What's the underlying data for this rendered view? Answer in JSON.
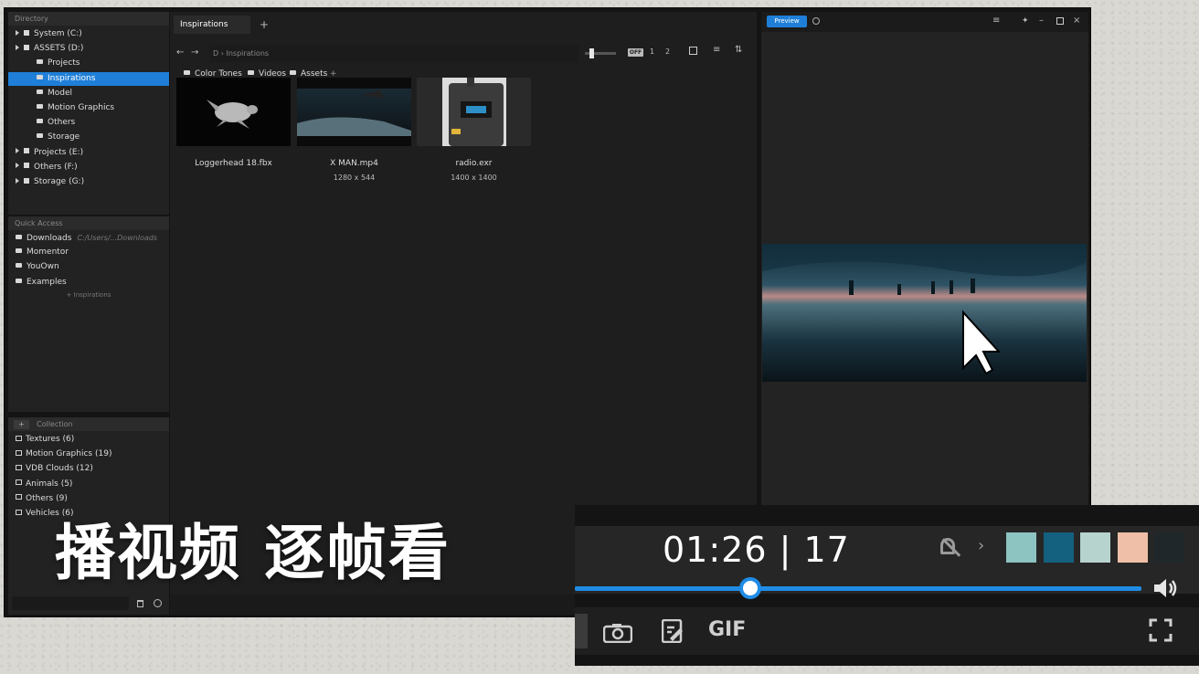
{
  "directory": {
    "header": "Directory",
    "items": [
      {
        "label": "System (C:)",
        "kind": "drive",
        "level": 0,
        "expandable": true
      },
      {
        "label": "ASSETS (D:)",
        "kind": "drive",
        "level": 0,
        "expandable": true
      },
      {
        "label": "Projects",
        "kind": "folder",
        "level": 1
      },
      {
        "label": "Inspirations",
        "kind": "folder",
        "level": 1,
        "selected": true
      },
      {
        "label": "Model",
        "kind": "folder",
        "level": 1
      },
      {
        "label": "Motion Graphics",
        "kind": "folder",
        "level": 1
      },
      {
        "label": "Others",
        "kind": "folder",
        "level": 1
      },
      {
        "label": "Storage",
        "kind": "folder",
        "level": 1
      },
      {
        "label": "Projects (E:)",
        "kind": "drive",
        "level": 0,
        "expandable": true
      },
      {
        "label": "Others (F:)",
        "kind": "drive",
        "level": 0,
        "expandable": true
      },
      {
        "label": "Storage (G:)",
        "kind": "drive",
        "level": 0,
        "expandable": true
      }
    ]
  },
  "quick_access": {
    "header": "Quick Access",
    "items": [
      {
        "label": "Downloads",
        "path": "C:/Users/...Downloads"
      },
      {
        "label": "Momentor",
        "path": ""
      },
      {
        "label": "YouOwn",
        "path": ""
      },
      {
        "label": "Examples",
        "path": ""
      }
    ],
    "add_label": "+ Inspirations"
  },
  "collection": {
    "header": "Collection",
    "add_icon": "+",
    "items": [
      {
        "label": "Textures (6)"
      },
      {
        "label": "Motion Graphics (19)"
      },
      {
        "label": "VDB Clouds (12)"
      },
      {
        "label": "Animals (5)"
      },
      {
        "label": "Others (9)"
      },
      {
        "label": "Vehicles (6)"
      }
    ]
  },
  "browser": {
    "tab_label": "Inspirations",
    "new_tab": "+",
    "path_drive": "D",
    "path_folder": "Inspirations",
    "toggle_label": "OFF",
    "view_1": "1",
    "view_2": "2",
    "crumbs": [
      "Color Tones",
      "Videos",
      "Assets"
    ],
    "crumb_add": "+",
    "files": [
      {
        "name": "Loggerhead 18.fbx",
        "dims": ""
      },
      {
        "name": "X MAN.mp4",
        "dims": "1280 x 544"
      },
      {
        "name": "radio.exr",
        "dims": "1400 x 1400"
      }
    ]
  },
  "preview": {
    "button_label": "Preview"
  },
  "overlay": {
    "caption": "播视频 逐帧看"
  },
  "player": {
    "timecode": "01:26 | 17",
    "gif_label": "GIF",
    "progress": 0.31,
    "swatches": [
      "#8dc3c1",
      "#14607f",
      "#b7d3cd",
      "#efbfa8",
      "#20272b"
    ]
  },
  "colors": {
    "accent": "#1f7fd8",
    "progress": "#1f8ce6",
    "panel": "#222222",
    "background": "#141414"
  }
}
